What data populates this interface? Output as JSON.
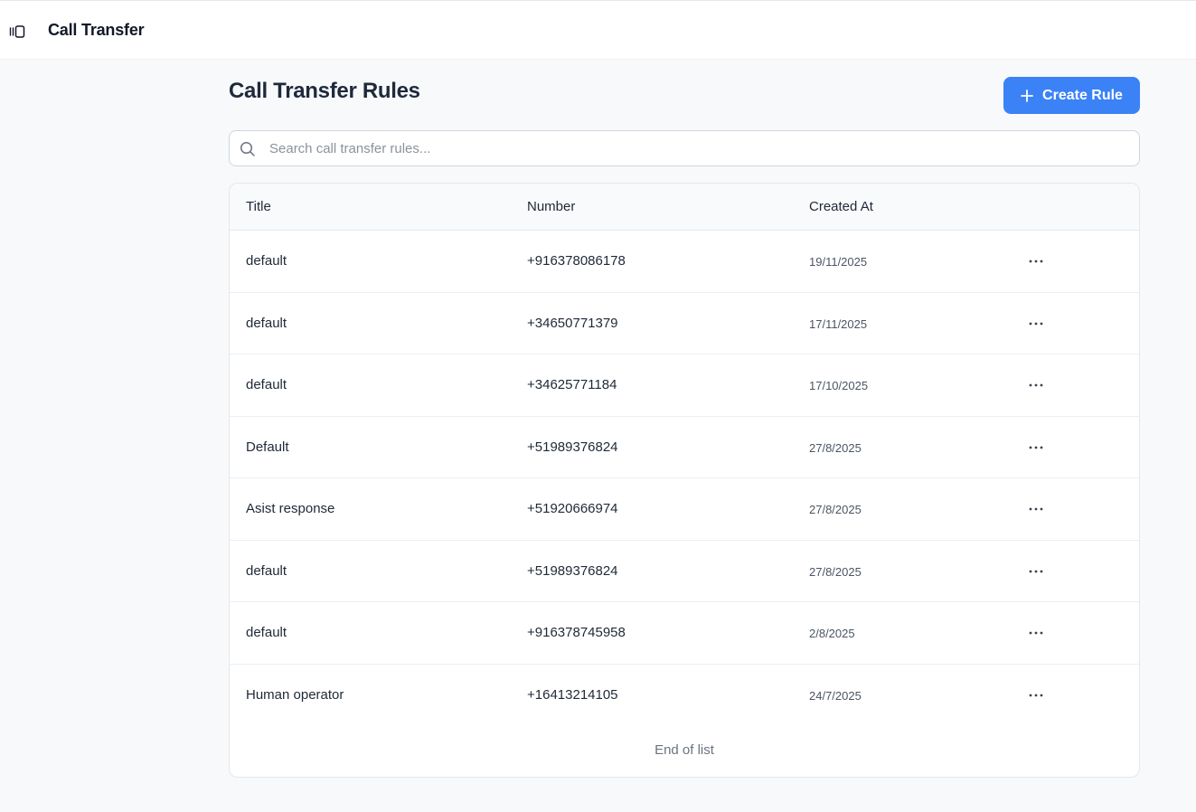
{
  "header": {
    "app_title": "Call Transfer",
    "toggle_icon": "sidebar-toggle-icon"
  },
  "page": {
    "title": "Call Transfer Rules",
    "create_button_label": "Create Rule",
    "create_button_icon": "plus-icon",
    "accent_color": "#3b82f6"
  },
  "search": {
    "placeholder": "Search call transfer rules...",
    "value": "",
    "icon": "search-icon"
  },
  "table": {
    "columns": [
      "Title",
      "Number",
      "Created At"
    ],
    "rows": [
      {
        "title": "default",
        "number": "+916378086178",
        "created_at": "19/11/2025"
      },
      {
        "title": "default",
        "number": "+34650771379",
        "created_at": "17/11/2025"
      },
      {
        "title": "default",
        "number": "+34625771184",
        "created_at": "17/10/2025"
      },
      {
        "title": "Default",
        "number": "+51989376824",
        "created_at": "27/8/2025"
      },
      {
        "title": "Asist response",
        "number": "+51920666974",
        "created_at": "27/8/2025"
      },
      {
        "title": "default",
        "number": "+51989376824",
        "created_at": "27/8/2025"
      },
      {
        "title": "default",
        "number": "+916378745958",
        "created_at": "2/8/2025"
      },
      {
        "title": "Human operator",
        "number": "+16413214105",
        "created_at": "24/7/2025"
      }
    ],
    "row_menu_icon": "more-horizontal-icon",
    "end_text": "End of list"
  }
}
